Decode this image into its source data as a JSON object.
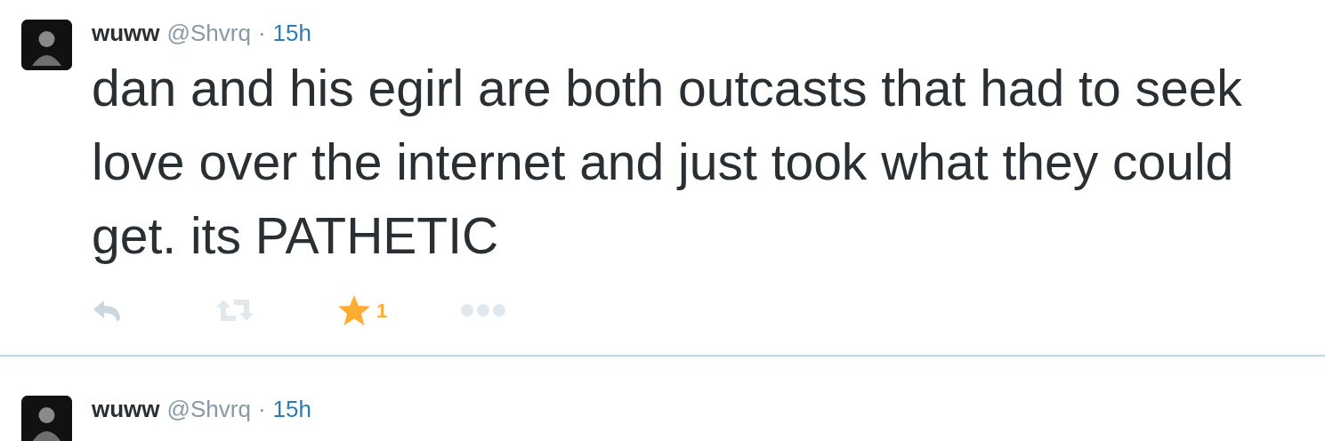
{
  "tweets": [
    {
      "name": "wuww",
      "handle": "@Shvrq",
      "separator": "·",
      "time": "15h",
      "text": "dan and his egirl are both outcasts that had to seek love over the internet and just took what they could get. its PATHETIC",
      "favorited": true,
      "favorite_count": "1"
    },
    {
      "name": "wuww",
      "handle": "@Shvrq",
      "separator": "·",
      "time": "15h"
    }
  ]
}
